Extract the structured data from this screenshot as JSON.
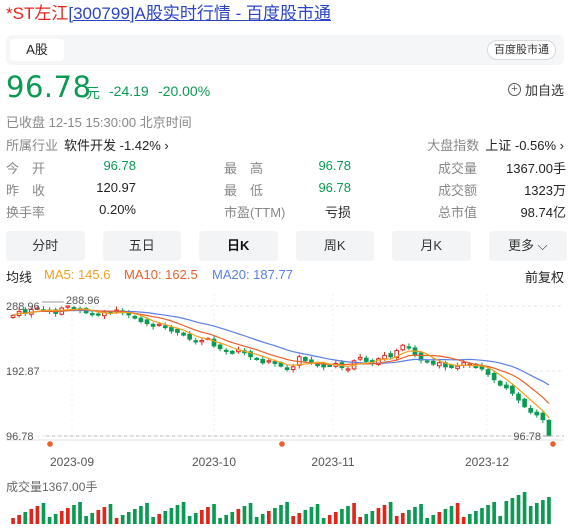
{
  "header": {
    "title_red": "*ST左江",
    "title_link": "[300799]A股实时行情 - 百度股市通"
  },
  "tabbar": {
    "market_tab": "A股",
    "source_badge": "百度股市通"
  },
  "quote": {
    "price": "96.78",
    "unit": "元",
    "change": "-24.19",
    "change_pct": "-20.00%",
    "add_watch": "加自选",
    "status": "已收盘 12-15 15:30:00 北京时间",
    "industry_label": "所属行业",
    "industry_value": "软件开发 -1.42% ›",
    "index_label": "大盘指数",
    "index_value": "上证 -0.56% ›",
    "colors": {
      "down": "#0b9a52",
      "up": "#e0251b"
    }
  },
  "stats": [
    [
      {
        "label": "今　开",
        "value": "96.78",
        "color": "green"
      },
      {
        "label": "最　高",
        "value": "96.78",
        "color": "green"
      },
      {
        "label": "成交量",
        "value": "1367.00手",
        "color": ""
      }
    ],
    [
      {
        "label": "昨　收",
        "value": "120.97",
        "color": ""
      },
      {
        "label": "最　低",
        "value": "96.78",
        "color": "green"
      },
      {
        "label": "成交额",
        "value": "1323万",
        "color": ""
      }
    ],
    [
      {
        "label": "换手率",
        "value": "0.20%",
        "color": ""
      },
      {
        "label": "市盈(TTM)",
        "value": "亏损",
        "color": ""
      },
      {
        "label": "总市值",
        "value": "98.74亿",
        "color": ""
      }
    ]
  ],
  "period_tabs": [
    "分时",
    "五日",
    "日K",
    "周K",
    "月K",
    "更多"
  ],
  "active_period": "日K",
  "ma": {
    "label": "均线",
    "ma5": "MA5: 145.6",
    "ma10": "MA10: 162.5",
    "ma20": "MA20: 187.77",
    "adjust": "前复权",
    "colors": {
      "ma5": "#f0a020",
      "ma10": "#e8602c",
      "ma20": "#5b7fe6"
    }
  },
  "chart_data": {
    "type": "candlestick",
    "y_ticks": [
      "288.96",
      "192.87",
      "96.78"
    ],
    "x_ticks": [
      "2023-09",
      "2023-10",
      "2023-11",
      "2023-12"
    ],
    "high_marker": "288.96",
    "low_marker": "96.78",
    "ylim": [
      96.78,
      288.96
    ],
    "closes": [
      275,
      281,
      278,
      284,
      286,
      283,
      281,
      278,
      286,
      289,
      285,
      283,
      279,
      276,
      277,
      280,
      278,
      283,
      279,
      276,
      271,
      266,
      263,
      259,
      262,
      257,
      252,
      250,
      246,
      240,
      236,
      238,
      241,
      230,
      226,
      222,
      219,
      224,
      220,
      214,
      210,
      205,
      208,
      204,
      200,
      195,
      199,
      214,
      208,
      205,
      202,
      199,
      201,
      204,
      198,
      196,
      208,
      213,
      207,
      205,
      211,
      216,
      214,
      223,
      231,
      227,
      217,
      209,
      206,
      203,
      205,
      199,
      198,
      200,
      205,
      203,
      198,
      196,
      188,
      180,
      172,
      168,
      160,
      150,
      140,
      132,
      128,
      120.97,
      96.78
    ],
    "volume_label": "成交量1367.00手"
  }
}
